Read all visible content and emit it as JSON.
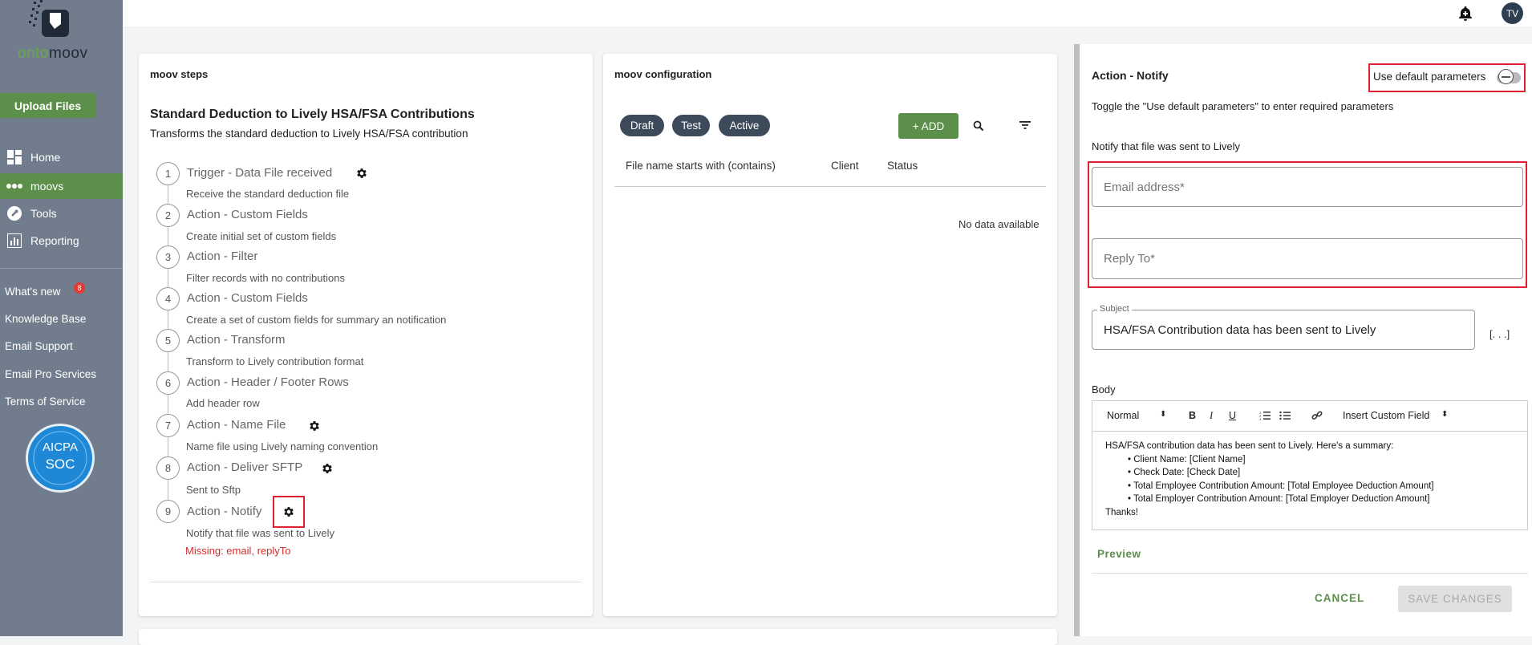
{
  "sidebar": {
    "logo_part1": "onto",
    "logo_part2": "moov",
    "upload_label": "Upload Files",
    "nav": [
      {
        "label": "Home",
        "icon": "dashboard-icon"
      },
      {
        "label": "moovs",
        "icon": "moovs-icon"
      },
      {
        "label": "Tools",
        "icon": "wrench-icon"
      },
      {
        "label": "Reporting",
        "icon": "chart-icon"
      }
    ],
    "links": [
      "What's new",
      "Knowledge Base",
      "Email Support",
      "Email Pro Services",
      "Terms of Service"
    ],
    "whats_new_badge": "8",
    "soc_badge_line1": "AICPA",
    "soc_badge_line2": "SOC"
  },
  "topbar": {
    "avatar_initials": "TV"
  },
  "steps_card": {
    "title": "moov steps",
    "heading": "Standard Deduction to Lively HSA/FSA Contributions",
    "subheading": "Transforms the standard deduction to Lively HSA/FSA contribution",
    "steps": [
      {
        "num": "1",
        "title": "Trigger - Data File received",
        "desc": "Receive the standard deduction file"
      },
      {
        "num": "2",
        "title": "Action - Custom Fields",
        "desc": "Create initial set of custom fields"
      },
      {
        "num": "3",
        "title": "Action - Filter",
        "desc": "Filter records with no contributions"
      },
      {
        "num": "4",
        "title": "Action - Custom Fields",
        "desc": "Create a set of custom fields for summary an notification"
      },
      {
        "num": "5",
        "title": "Action - Transform",
        "desc": "Transform to Lively contribution format"
      },
      {
        "num": "6",
        "title": "Action - Header / Footer Rows",
        "desc": "Add header row"
      },
      {
        "num": "7",
        "title": "Action - Name File",
        "desc": "Name file using Lively naming convention"
      },
      {
        "num": "8",
        "title": "Action - Deliver SFTP",
        "desc": "Sent to Sftp"
      },
      {
        "num": "9",
        "title": "Action - Notify",
        "desc": "Notify that file was sent to Lively"
      }
    ],
    "missing_text": "Missing: email, replyTo"
  },
  "config_card": {
    "title": "moov configuration",
    "chips": [
      "Draft",
      "Test",
      "Active"
    ],
    "add_label": "+ ADD",
    "columns": [
      "File name starts with (contains)",
      "Client",
      "Status"
    ],
    "empty_text": "No data available"
  },
  "notify_panel": {
    "title": "Action - Notify",
    "toggle_label": "Use default parameters",
    "hint": "Toggle the \"Use default parameters\" to enter required parameters",
    "section_label": "Notify that file was sent to Lively",
    "email_placeholder": "Email address*",
    "reply_placeholder": "Reply To*",
    "subject_label": "Subject",
    "subject_value": "HSA/FSA Contribution data has been sent to Lively",
    "ellipsis": "[. . .]",
    "body_label": "Body",
    "toolbar": {
      "format": "Normal",
      "bold": "B",
      "italic": "I",
      "underline": "U",
      "insert_field": "Insert Custom Field"
    },
    "body_lines": [
      "HSA/FSA contribution data has been sent to Lively. Here's a summary:",
      "• Client Name: [Client Name]",
      "• Check Date: [Check Date]",
      "• Total Employee Contribution Amount: [Total Employee Deduction Amount]",
      "• Total Employer Contribution Amount: [Total Employer Deduction Amount]",
      "Thanks!"
    ],
    "preview_label": "Preview",
    "cancel_label": "CANCEL",
    "save_label": "SAVE CHANGES"
  }
}
